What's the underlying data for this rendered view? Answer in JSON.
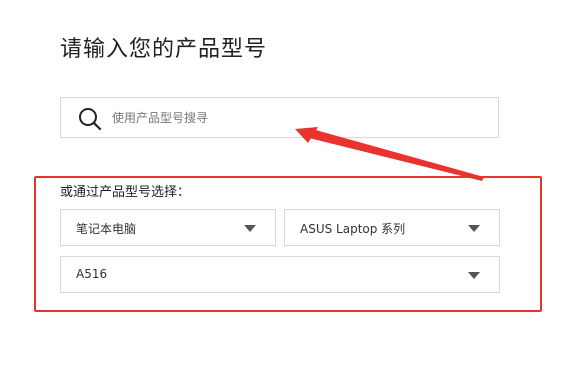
{
  "page": {
    "title": "请输入您的产品型号"
  },
  "search": {
    "placeholder": "使用产品型号搜寻",
    "value": "",
    "icon": "search-icon"
  },
  "selection": {
    "label": "或通过产品型号选择：",
    "category": {
      "value": "笔记本电脑",
      "icon": "chevron-down-icon"
    },
    "series": {
      "value": "ASUS Laptop 系列",
      "icon": "chevron-down-icon"
    },
    "model": {
      "value": "A516",
      "icon": "chevron-down-icon"
    }
  },
  "annotation": {
    "color": "#e8332e",
    "icon": "arrow-annotation-icon"
  }
}
